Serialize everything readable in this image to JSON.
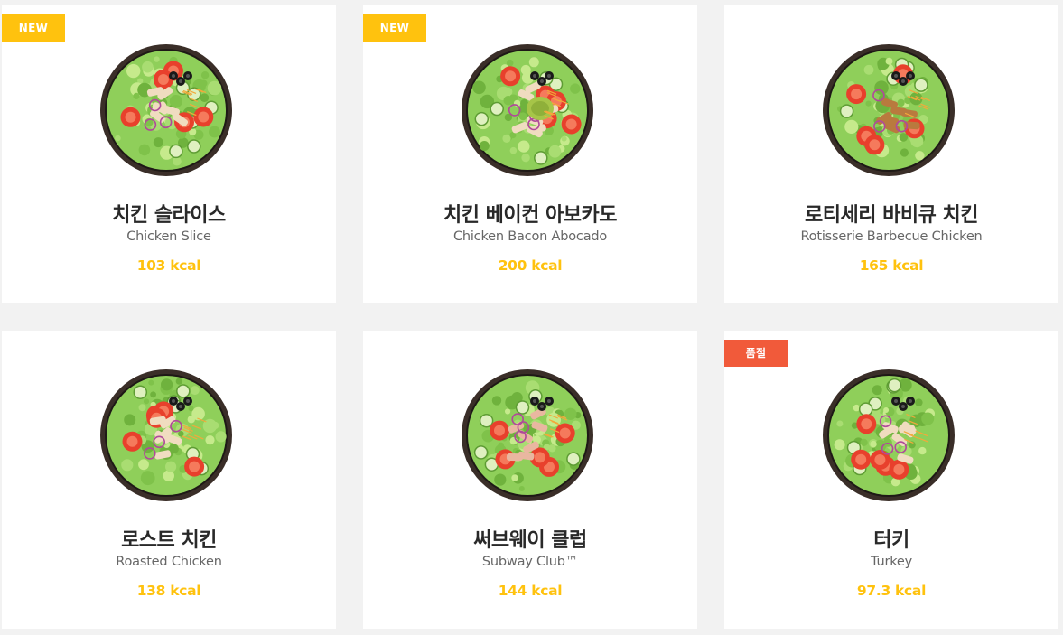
{
  "colors": {
    "page_background": "#f2f2f2",
    "card_background": "#ffffff",
    "new_badge": "#ffc20e",
    "soldout_badge": "#f15a3a",
    "kcal_text": "#ffc20e"
  },
  "products": [
    {
      "name_ko": "치킨 슬라이스",
      "name_en": "Chicken Slice",
      "kcal": "103 kcal",
      "badge": "NEW",
      "badge_type": "new",
      "topping": "chicken-slice",
      "image_icon": "salad-bowl-icon"
    },
    {
      "name_ko": "치킨 베이컨 아보카도",
      "name_en": "Chicken Bacon Abocado",
      "kcal": "200 kcal",
      "badge": "NEW",
      "badge_type": "new",
      "topping": "avocado",
      "image_icon": "salad-bowl-icon"
    },
    {
      "name_ko": "로티세리 바비큐 치킨",
      "name_en": "Rotisserie Barbecue Chicken",
      "kcal": "165 kcal",
      "badge": "",
      "badge_type": "",
      "topping": "bbq-chicken",
      "image_icon": "salad-bowl-icon"
    },
    {
      "name_ko": "로스트 치킨",
      "name_en": "Roasted Chicken",
      "kcal": "138 kcal",
      "badge": "",
      "badge_type": "",
      "topping": "roasted-chicken",
      "image_icon": "salad-bowl-icon"
    },
    {
      "name_ko": "써브웨이 클럽",
      "name_en": "Subway Club™",
      "kcal": "144 kcal",
      "badge": "",
      "badge_type": "",
      "topping": "club",
      "image_icon": "salad-bowl-icon"
    },
    {
      "name_ko": "터키",
      "name_en": "Turkey",
      "kcal": "97.3 kcal",
      "badge": "품절",
      "badge_type": "soldout",
      "topping": "turkey",
      "image_icon": "salad-bowl-icon"
    }
  ]
}
